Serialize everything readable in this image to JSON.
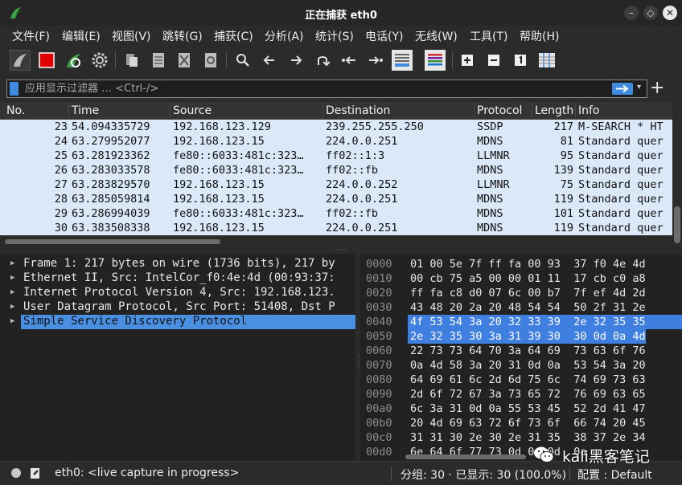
{
  "window": {
    "title": "正在捕获 eth0"
  },
  "menu": [
    "文件(F)",
    "编辑(E)",
    "视图(V)",
    "跳转(G)",
    "捕获(C)",
    "分析(A)",
    "统计(S)",
    "电话(Y)",
    "无线(W)",
    "工具(T)",
    "帮助(H)"
  ],
  "toolbar": {
    "icons": [
      "shark-fin-start-icon",
      "stop-capture-icon",
      "restart-capture-icon",
      "capture-options-gear-icon",
      "open-file-icon",
      "save-file-icon",
      "close-file-icon",
      "reload-file-icon",
      "find-packet-icon",
      "go-back-icon",
      "go-forward-icon",
      "go-to-packet-icon",
      "go-first-packet-icon",
      "go-last-packet-icon",
      "auto-scroll-icon",
      "colorize-icon",
      "zoom-in-icon",
      "zoom-out-icon",
      "normal-size-icon",
      "resize-columns-icon"
    ]
  },
  "filter": {
    "placeholder": "应用显示过滤器 … <Ctrl-/>",
    "value": ""
  },
  "packet_list": {
    "columns": [
      "No.",
      "Time",
      "Source",
      "Destination",
      "Protocol",
      "Length",
      "Info"
    ],
    "rows": [
      {
        "no": "23",
        "time": "54.094335729",
        "source": "192.168.123.129",
        "destination": "239.255.255.250",
        "protocol": "SSDP",
        "length": "217",
        "info": "M-SEARCH * HT"
      },
      {
        "no": "24",
        "time": "63.279952077",
        "source": "192.168.123.15",
        "destination": "224.0.0.251",
        "protocol": "MDNS",
        "length": "81",
        "info": "Standard quer"
      },
      {
        "no": "25",
        "time": "63.281923362",
        "source": "fe80::6033:481c:323…",
        "destination": "ff02::1:3",
        "protocol": "LLMNR",
        "length": "95",
        "info": "Standard quer"
      },
      {
        "no": "26",
        "time": "63.283033578",
        "source": "fe80::6033:481c:323…",
        "destination": "ff02::fb",
        "protocol": "MDNS",
        "length": "139",
        "info": "Standard quer"
      },
      {
        "no": "27",
        "time": "63.283829570",
        "source": "192.168.123.15",
        "destination": "224.0.0.252",
        "protocol": "LLMNR",
        "length": "75",
        "info": "Standard quer"
      },
      {
        "no": "28",
        "time": "63.285059814",
        "source": "192.168.123.15",
        "destination": "224.0.0.251",
        "protocol": "MDNS",
        "length": "119",
        "info": "Standard quer"
      },
      {
        "no": "29",
        "time": "63.286994039",
        "source": "fe80::6033:481c:323…",
        "destination": "ff02::fb",
        "protocol": "MDNS",
        "length": "101",
        "info": "Standard quer"
      },
      {
        "no": "30",
        "time": "63.383508338",
        "source": "192.168.123.15",
        "destination": "224.0.0.251",
        "protocol": "MDNS",
        "length": "119",
        "info": "Standard quer"
      }
    ]
  },
  "details": [
    {
      "text": "Frame 1: 217 bytes on wire (1736 bits), 217 by",
      "selected": false
    },
    {
      "text": "Ethernet II, Src: IntelCor_f0:4e:4d (00:93:37:",
      "selected": false
    },
    {
      "text": "Internet Protocol Version 4, Src: 192.168.123.",
      "selected": false
    },
    {
      "text": "User Datagram Protocol, Src Port: 51408, Dst P",
      "selected": false
    },
    {
      "text": "Simple Service Discovery Protocol",
      "selected": true
    }
  ],
  "bytes": [
    {
      "offset": "0000",
      "hex": "01 00 5e 7f ff fa 00 93  37 f0 4e 4d"
    },
    {
      "offset": "0010",
      "hex": "00 cb 75 a5 00 00 01 11  17 cb c0 a8"
    },
    {
      "offset": "0020",
      "hex": "ff fa c8 d0 07 6c 00 b7  7f ef 4d 2d"
    },
    {
      "offset": "0030",
      "hex": "43 48 20 2a 20 48 54 54  50 2f 31 2e"
    },
    {
      "offset": "0040",
      "hex": "4f 53 54 3a 20 32 33 39  2e 32 35 35"
    },
    {
      "offset": "0050",
      "hex": "2e 32 35 30 3a 31 39 30  30 0d 0a 4d"
    },
    {
      "offset": "0060",
      "hex": "22 73 73 64 70 3a 64 69  73 63 6f 76"
    },
    {
      "offset": "0070",
      "hex": "0a 4d 58 3a 20 31 0d 0a  53 54 3a 20"
    },
    {
      "offset": "0080",
      "hex": "64 69 61 6c 2d 6d 75 6c  74 69 73 63"
    },
    {
      "offset": "0090",
      "hex": "2d 6f 72 67 3a 73 65 72  76 69 63 65"
    },
    {
      "offset": "00a0",
      "hex": "6c 3a 31 0d 0a 55 53 45  52 2d 41 47"
    },
    {
      "offset": "00b0",
      "hex": "20 4d 69 63 72 6f 73 6f  66 74 20 45"
    },
    {
      "offset": "00c0",
      "hex": "31 31 30 2e 30 2e 31 35  38 37 2e 34"
    },
    {
      "offset": "00d0",
      "hex": "6e 64 6f 77 73 0d 0a 0d  0a"
    }
  ],
  "status": {
    "interface": "eth0: <live capture in progress>",
    "packets": "分组: 30 · 已显示: 30 (100.0%)",
    "profile": "配置 : Default"
  },
  "watermark": {
    "text": "kali黑客笔记"
  },
  "colors": {
    "accent": "#3f8be0",
    "row_bg": "#dbe8f8",
    "selection": "#4a90e2",
    "stop_red": "#e00000",
    "shark_green": "#4caf50"
  }
}
